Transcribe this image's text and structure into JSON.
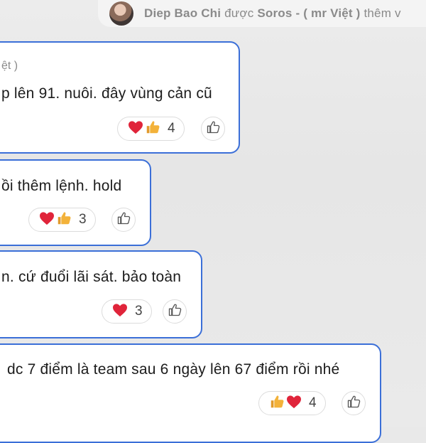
{
  "notice": {
    "user": "Diep Bao Chi",
    "verb": "được",
    "adder": "Soros - ( mr Việt )",
    "action": "thêm v"
  },
  "messages": [
    {
      "meta": "ệt )",
      "text": "p lên 91. nuôi. đây vùng cản cũ",
      "reaction_count": "4",
      "reaction_icons": [
        "heart-icon",
        "thumbs-up-icon"
      ]
    },
    {
      "text": "ồi thêm lệnh. hold",
      "reaction_count": "3",
      "reaction_icons": [
        "heart-icon",
        "thumbs-up-icon"
      ]
    },
    {
      "text": "n. cứ đuổi lãi sát. bảo toàn",
      "reaction_count": "3",
      "reaction_icons": [
        "heart-icon"
      ]
    },
    {
      "text": "dc 7 điểm là team sau 6 ngày lên 67 điểm rồi nhé",
      "reaction_count": "4",
      "reaction_icons": [
        "thumbs-up-icon",
        "heart-icon"
      ]
    }
  ],
  "colors": {
    "bubble_border": "#3b6fd8",
    "heart": "#e0243a",
    "thumbs_up": "#f3b23a"
  }
}
